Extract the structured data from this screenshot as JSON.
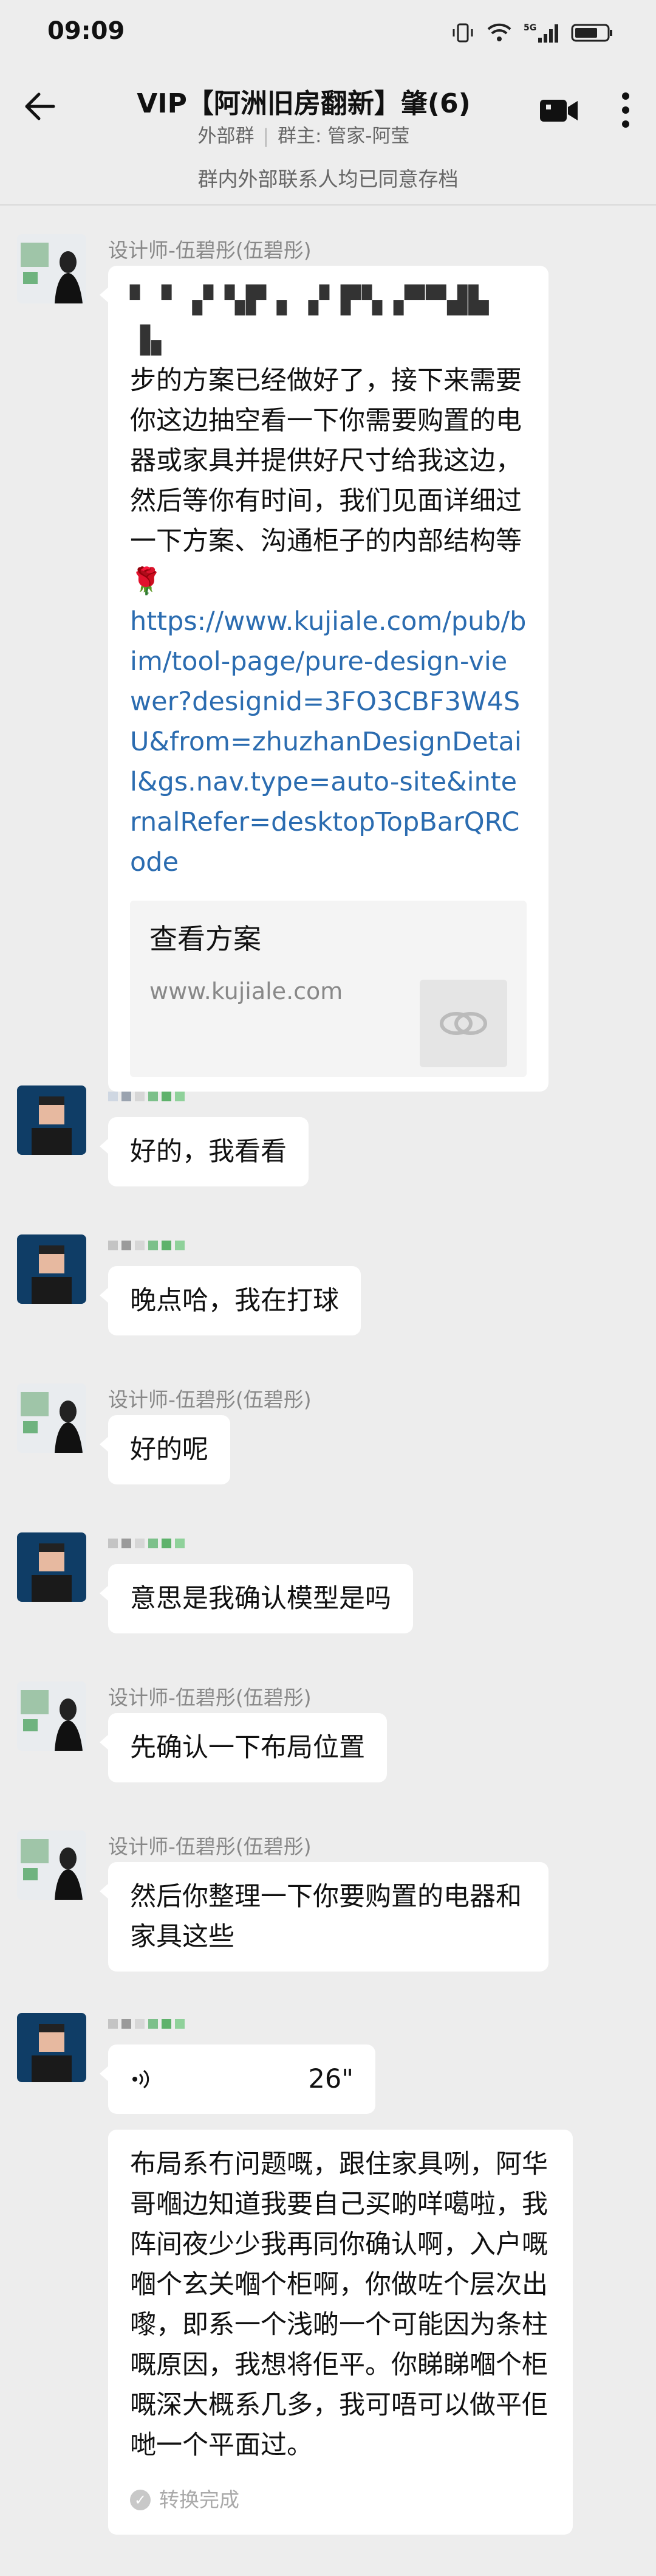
{
  "status": {
    "time": "09:09",
    "network": "5G"
  },
  "header": {
    "title": "VIP【阿洲旧房翻新】肇(6)",
    "tag": "外部群",
    "owner": "群主: 管家-阿莹"
  },
  "notice": "群内外部联系人均已同意存档",
  "messages": [
    {
      "sender": "设计师-伍碧彤(伍碧彤)",
      "masked_head": "▘▝ ▗▘▚▛ ▖▗▘▛▚▗▀▀▟▙ ▐▖",
      "text": "步的方案已经做好了，接下来需要你这边抽空看一下你需要购置的电器或家具并提供好尺寸给我这边，然后等你有时间，我们见面详细过一下方案、沟通柜子的内部结构等🌹",
      "link": "https://www.kujiale.com/pub/bim/tool-page/pure-design-viewer?designid=3FO3CBF3W4SU&from=zhuzhanDesignDetail&gs.nav.type=auto-site&internalRefer=desktopTopBarQRCode",
      "card_title": "查看方案",
      "card_url": "www.kujiale.com"
    },
    {
      "text": "好的，我看看"
    },
    {
      "text": "晚点哈，我在打球"
    },
    {
      "sender": "设计师-伍碧彤(伍碧彤)",
      "text": "好的呢"
    },
    {
      "text": "意思是我确认模型是吗"
    },
    {
      "sender": "设计师-伍碧彤(伍碧彤)",
      "text": "先确认一下布局位置"
    },
    {
      "sender": "设计师-伍碧彤(伍碧彤)",
      "text": "然后你整理一下你要购置的电器和家具这些"
    },
    {
      "voice_duration": "26\"",
      "transcript": "布局系冇问题嘅，跟住家具咧，阿华哥嗰边知道我要自己买啲咩噶啦，我阵间夜少少我再同你确认啊，入户嘅嗰个玄关嗰个柜啊，你做咗个层次出嚟，即系一个浅啲一个可能因为条柱嘅原因，我想将佢平。你睇睇嗰个柜嘅深大概系几多，我可唔可以做平佢哋一个平面过。",
      "transcript_status": "转换完成"
    }
  ]
}
